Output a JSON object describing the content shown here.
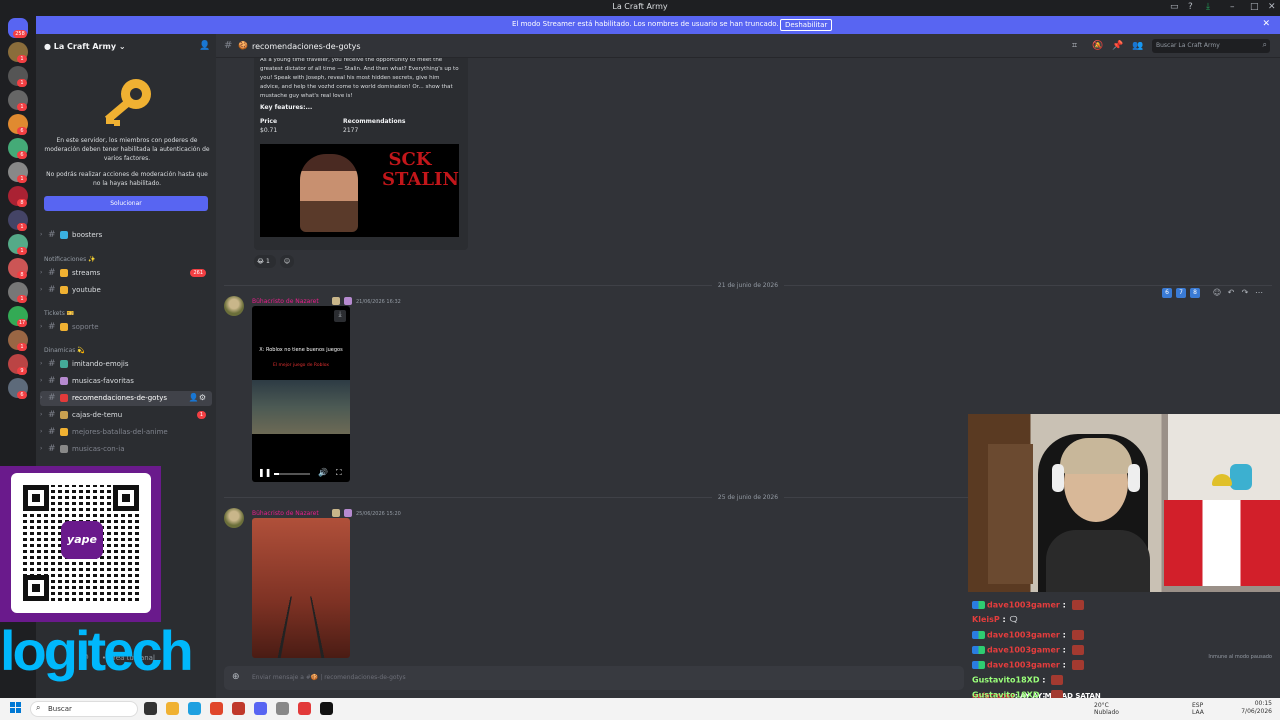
{
  "window": {
    "title": "La Craft Army"
  },
  "banner": {
    "text": "El modo Streamer está habilitado. Los nombres de usuario se han truncado.",
    "button": "Deshabilitar"
  },
  "rail": {
    "top_badge": "258",
    "badges": [
      "1",
      "1",
      "1",
      "6",
      "6",
      "1",
      "8",
      "1",
      "1",
      "8",
      "1",
      "17",
      "1",
      "9",
      "6"
    ]
  },
  "sidebar": {
    "server_name": "La Craft Army",
    "mfa_text_1": "En este servidor, los miembros con poderes de moderación deben tener habilitada la autenticación de varios factores.",
    "mfa_text_2": "No podrás realizar acciones de moderación hasta que no la hayas habilitado.",
    "fix_button": "Solucionar",
    "channels": [
      {
        "name": "boosters",
        "muted": false
      },
      {
        "category": "Notificaciones ✨"
      },
      {
        "name": "streams",
        "muted": false,
        "count": "261"
      },
      {
        "name": "youtube",
        "muted": false
      },
      {
        "category": "Tickets 🎫"
      },
      {
        "name": "soporte",
        "muted": true
      },
      {
        "category": "Dinamicas 💫"
      },
      {
        "name": "imitando-emojis",
        "muted": false
      },
      {
        "name": "musicas-favoritas",
        "muted": false
      },
      {
        "name": "recomendaciones-de-gotys",
        "muted": false,
        "active": true
      },
      {
        "name": "cajas-de-temu",
        "muted": false,
        "count": "1"
      },
      {
        "name": "mejores-batallas-del-anime",
        "muted": true
      },
      {
        "name": "musicas-con-ia",
        "muted": true
      }
    ],
    "create_channel": "Crea tu canal",
    "status": "No molestar"
  },
  "overlay": {
    "qr_brand": "yape",
    "logo_text": "logitech",
    "logo_tm": "TM"
  },
  "header": {
    "channel_name": "recomendaciones-de-gotys",
    "search_placeholder": "Buscar La Craft Army"
  },
  "embed": {
    "description": "As a young time traveler, you receive the opportunity to meet the greatest dictator of all time — Stalin. And then what? Everything's up to you! Speak with Joseph, reveal his most hidden secrets, give him advice, and help the vozhd come to world domination! Or... show that mustache guy what's real love is!",
    "key_features": "Key features:...",
    "price_label": "Price",
    "price_value": "$0.71",
    "recs_label": "Recommendations",
    "recs_value": "2177",
    "image_title": "SCK STALIN",
    "reaction_count": "1"
  },
  "messages": [
    {
      "divider": "21 de junio de 2026",
      "author": "Bühacristo de Nazaret",
      "timestamp": "21/06/2026 16:32",
      "video_text_1": "X: Roblox no tiene buenos juegos",
      "video_text_2": "El mejor juego de Roblox",
      "video_progress": 0.15
    },
    {
      "divider": "25 de junio de 2026",
      "author": "Bühacristo de Nazaret",
      "timestamp": "25/06/2026 15:20"
    }
  ],
  "hover_actions": [
    "6",
    "7",
    "8"
  ],
  "composer": {
    "placeholder": "Enviar mensaje a #🍪 | recomendaciones-de-gotys"
  },
  "chat": {
    "lines": [
      {
        "user": "dave1003gamer",
        "color": "red",
        "badge": true,
        "emote": true
      },
      {
        "user": "KleisP",
        "color": "red",
        "badge": false,
        "emote": false,
        "suffix": "🗨"
      },
      {
        "user": "dave1003gamer",
        "color": "red",
        "badge": true,
        "emote": true
      },
      {
        "user": "dave1003gamer",
        "color": "red",
        "badge": true,
        "emote": true
      },
      {
        "user": "dave1003gamer",
        "color": "red",
        "badge": true,
        "emote": true
      },
      {
        "user": "Gustavito18XD",
        "color": "green",
        "badge": false,
        "emote": true
      },
      {
        "user": "Gustavito18XD",
        "color": "green",
        "badge": false,
        "emote": true
      }
    ],
    "paused": "Inmune al modo pausado",
    "last_user": "nofatrace9",
    "last_text": "AY AY MI SAD SATAN"
  },
  "taskbar": {
    "search": "Buscar",
    "weather": "20°C Nublado",
    "lang_1": "ESP",
    "lang_2": "LAA",
    "time": "00:15",
    "date": "7/06/2026"
  }
}
